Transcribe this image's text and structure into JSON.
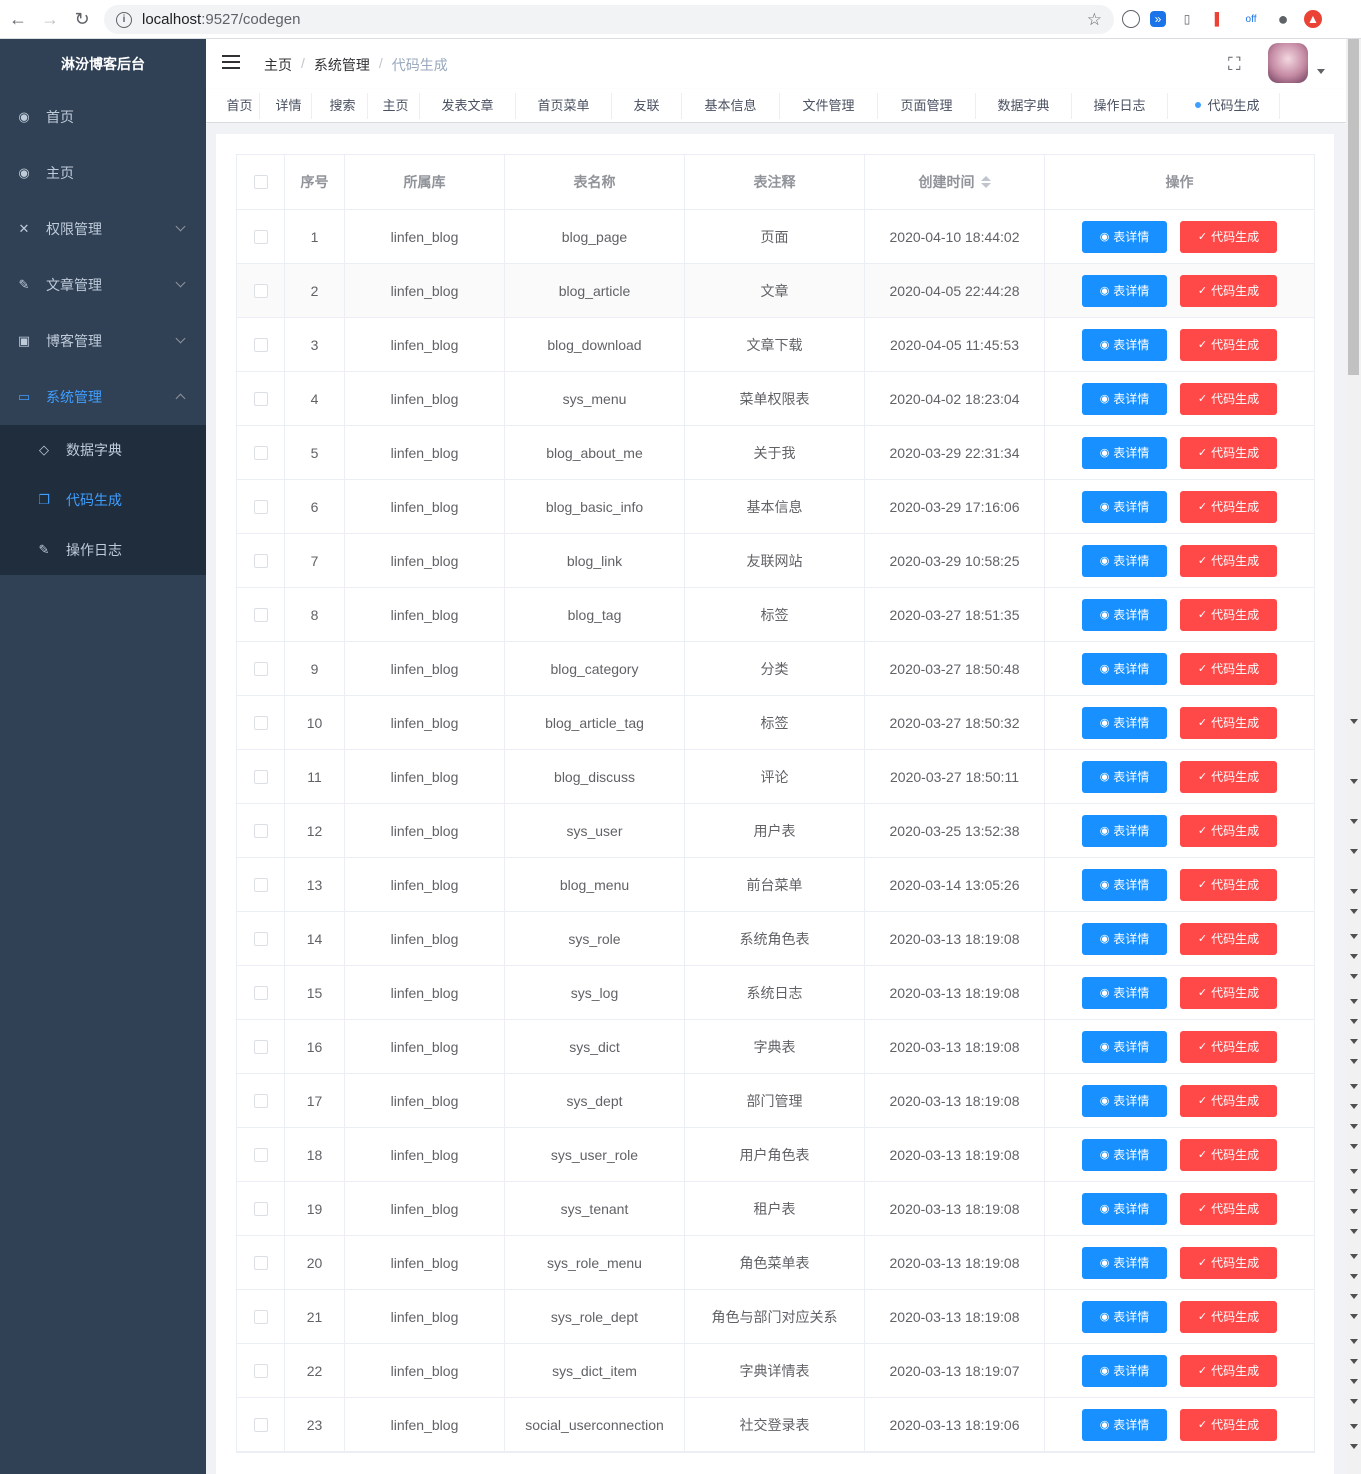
{
  "browser": {
    "url_host": "localhost",
    "url_path": ":9527/codegen"
  },
  "sidebar": {
    "brand": "淋汾博客后台",
    "items": [
      {
        "label": "首页",
        "icon": "dashboard-icon",
        "glyph": "◉"
      },
      {
        "label": "主页",
        "icon": "dashboard-icon",
        "glyph": "◉"
      },
      {
        "label": "权限管理",
        "icon": "tools-icon",
        "glyph": "✕"
      },
      {
        "label": "文章管理",
        "icon": "edit-icon",
        "glyph": "✎"
      },
      {
        "label": "博客管理",
        "icon": "image-icon",
        "glyph": "▣"
      },
      {
        "label": "系统管理",
        "icon": "monitor-icon",
        "glyph": "▭"
      }
    ],
    "subitems": [
      {
        "label": "数据字典",
        "icon": "tag-icon",
        "glyph": "◇"
      },
      {
        "label": "代码生成",
        "icon": "copy-icon",
        "glyph": "❐"
      },
      {
        "label": "操作日志",
        "icon": "edit-icon",
        "glyph": "✎"
      }
    ]
  },
  "header": {
    "breadcrumb": [
      "主页",
      "系统管理",
      "代码生成"
    ]
  },
  "tags": [
    "首页",
    "详情",
    "搜索",
    "主页",
    "发表文章",
    "首页菜单",
    "友联",
    "基本信息",
    "文件管理",
    "页面管理",
    "数据字典",
    "操作日志",
    "代码生成"
  ],
  "table": {
    "headers": [
      "序号",
      "所属库",
      "表名称",
      "表注释",
      "创建时间",
      "操作"
    ],
    "detail_label": "表详情",
    "gen_label": "代码生成",
    "rows": [
      [
        "1",
        "linfen_blog",
        "blog_page",
        "页面",
        "2020-04-10 18:44:02"
      ],
      [
        "2",
        "linfen_blog",
        "blog_article",
        "文章",
        "2020-04-05 22:44:28"
      ],
      [
        "3",
        "linfen_blog",
        "blog_download",
        "文章下载",
        "2020-04-05 11:45:53"
      ],
      [
        "4",
        "linfen_blog",
        "sys_menu",
        "菜单权限表",
        "2020-04-02 18:23:04"
      ],
      [
        "5",
        "linfen_blog",
        "blog_about_me",
        "关于我",
        "2020-03-29 22:31:34"
      ],
      [
        "6",
        "linfen_blog",
        "blog_basic_info",
        "基本信息",
        "2020-03-29 17:16:06"
      ],
      [
        "7",
        "linfen_blog",
        "blog_link",
        "友联网站",
        "2020-03-29 10:58:25"
      ],
      [
        "8",
        "linfen_blog",
        "blog_tag",
        "标签",
        "2020-03-27 18:51:35"
      ],
      [
        "9",
        "linfen_blog",
        "blog_category",
        "分类",
        "2020-03-27 18:50:48"
      ],
      [
        "10",
        "linfen_blog",
        "blog_article_tag",
        "标签",
        "2020-03-27 18:50:32"
      ],
      [
        "11",
        "linfen_blog",
        "blog_discuss",
        "评论",
        "2020-03-27 18:50:11"
      ],
      [
        "12",
        "linfen_blog",
        "sys_user",
        "用户表",
        "2020-03-25 13:52:38"
      ],
      [
        "13",
        "linfen_blog",
        "blog_menu",
        "前台菜单",
        "2020-03-14 13:05:26"
      ],
      [
        "14",
        "linfen_blog",
        "sys_role",
        "系统角色表",
        "2020-03-13 18:19:08"
      ],
      [
        "15",
        "linfen_blog",
        "sys_log",
        "系统日志",
        "2020-03-13 18:19:08"
      ],
      [
        "16",
        "linfen_blog",
        "sys_dict",
        "字典表",
        "2020-03-13 18:19:08"
      ],
      [
        "17",
        "linfen_blog",
        "sys_dept",
        "部门管理",
        "2020-03-13 18:19:08"
      ],
      [
        "18",
        "linfen_blog",
        "sys_user_role",
        "用户角色表",
        "2020-03-13 18:19:08"
      ],
      [
        "19",
        "linfen_blog",
        "sys_tenant",
        "租户表",
        "2020-03-13 18:19:08"
      ],
      [
        "20",
        "linfen_blog",
        "sys_role_menu",
        "角色菜单表",
        "2020-03-13 18:19:08"
      ],
      [
        "21",
        "linfen_blog",
        "sys_role_dept",
        "角色与部门对应关系",
        "2020-03-13 18:19:08"
      ],
      [
        "22",
        "linfen_blog",
        "sys_dict_item",
        "字典详情表",
        "2020-03-13 18:19:07"
      ],
      [
        "23",
        "linfen_blog",
        "social_userconnection",
        "社交登录表",
        "2020-03-13 18:19:06"
      ]
    ]
  },
  "colors": {
    "sidebar_bg": "#304156",
    "accent": "#409eff",
    "detail_button": "#1890ff",
    "gen_button": "#ff4949"
  }
}
